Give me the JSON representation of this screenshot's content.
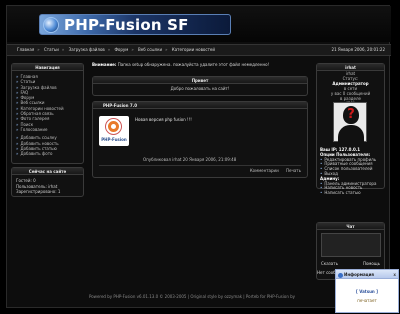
{
  "site": {
    "logo_text": "PHP-Fusion SF"
  },
  "topnav": {
    "links": [
      "Главная",
      "Статьи",
      "Загрузка файлов",
      "Форум",
      "Веб ссылки",
      "Категории новостей"
    ],
    "separator": "»",
    "date": "21 Января 2006, 20:01:22"
  },
  "navigation": {
    "title": "Навигация",
    "items": [
      "Главная",
      "Статьи",
      "Загрузка файлов",
      "FAQ",
      "Форум",
      "Веб ссылки",
      "Категории новостей",
      "Обратная связь",
      "Фото галерея",
      "Поиск",
      "Голосование"
    ],
    "items2": [
      "Добавить ссылку",
      "Добавить новость",
      "Добавить статью",
      "Добавить фото"
    ]
  },
  "online": {
    "title": "Сейчас на сайте",
    "guests": "Гостей: 0",
    "members": "Пользователь: irhat",
    "registered": "Зарегистрировано: 1"
  },
  "notice": {
    "label": "Внимание:",
    "text": "Папка setup обнаружена. пожалуйста удалите этот файл немедленно!"
  },
  "welcome": {
    "title": "Привет",
    "text": "Добро пожаловать на сайт!"
  },
  "news": {
    "title": "PHP-Fusion 7.0",
    "logo_label": "PHP-Fusion",
    "body": "Новая версия php fusion !!!",
    "meta": "Опубликовал irhat 20 Января 2006, 21:09:48",
    "comments": "Комментарии",
    "print": "Печать"
  },
  "user": {
    "title": "irhat",
    "status_lines": [
      "irhat",
      "Статус:",
      "Администратор",
      "в сети",
      "у вас 0 сообщений",
      "в разделе",
      "[29]"
    ],
    "info_header": "Ваш IP: 127.0.0.1",
    "options_title": "Опции Пользователя:",
    "options": [
      "Редактировать профиль",
      "Приватные сообщения",
      "Список пользователей",
      "Выход"
    ],
    "admin_title": "Админу:",
    "admin_items": [
      "Панель администратора",
      "Написать новость",
      "Написать статью"
    ]
  },
  "shout": {
    "title": "Чат",
    "send": "Сказать",
    "help": "Помощь",
    "hint": "Нет сообщений"
  },
  "popup": {
    "title": "Информация",
    "user": "[ Vatsun ]",
    "action": "печатает",
    "close": "x"
  },
  "footer": {
    "text": "Powered by PHP-Fusion v6.01.13.0 © 2003-2005 | Original style by ozzymak | Porteb for PHP-Fusion by"
  }
}
